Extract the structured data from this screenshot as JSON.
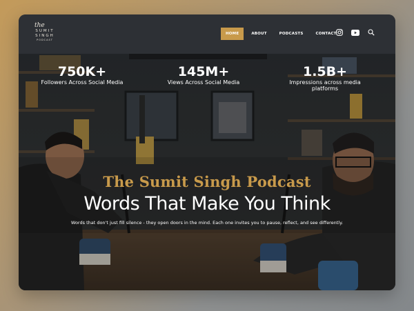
{
  "logo": {
    "line0": "the",
    "line1": "SUMIT",
    "line2": "SINGH",
    "line3": "PODCAST"
  },
  "nav": {
    "items": [
      {
        "label": "HOME",
        "active": true
      },
      {
        "label": "ABOUT",
        "active": false
      },
      {
        "label": "PODCASTS",
        "active": false
      },
      {
        "label": "CONTACT",
        "active": false
      }
    ],
    "icons": [
      "instagram-icon",
      "youtube-icon",
      "search-icon"
    ]
  },
  "stats": [
    {
      "value": "750K+",
      "label": "Followers Across Social Media"
    },
    {
      "value": "145M+",
      "label": "Views Across Social Media"
    },
    {
      "value": "1.5B+",
      "label_line1": "Impressions across media",
      "label_line2": "platforms"
    }
  ],
  "hero": {
    "podcast_name": "The Sumit Singh Podcast",
    "headline": "Words That Make You Think",
    "tagline": "Words that don't just fill silence - they open doors in the mind. Each one invites you to pause, reflect, and see differently."
  },
  "colors": {
    "accent": "#c89a4b",
    "nav_bg": "#2d3035",
    "text": "#ffffff"
  }
}
